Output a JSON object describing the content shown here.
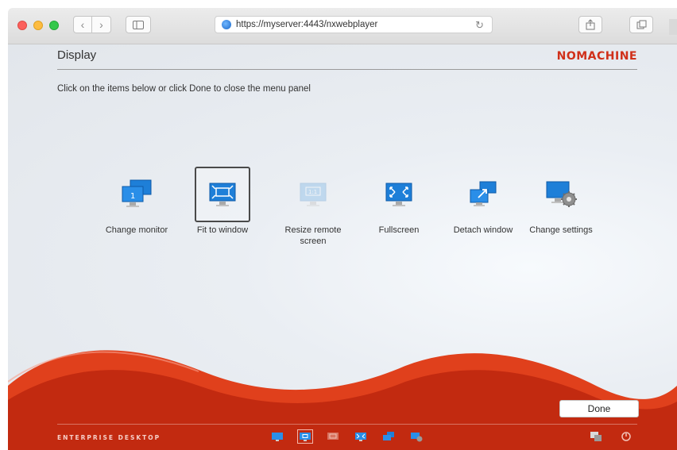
{
  "browser": {
    "url": "https://myserver:4443/nxwebplayer",
    "back_glyph": "‹",
    "forward_glyph": "›",
    "reload_glyph": "↻"
  },
  "header": {
    "title": "Display",
    "brand": "NOMACHINE"
  },
  "instruction": "Click on the items below or click Done to close the menu panel",
  "items": [
    {
      "label": "Change monitor",
      "icon": "change-monitor-icon",
      "selected": false,
      "disabled": false
    },
    {
      "label": "Fit to window",
      "icon": "fit-to-window-icon",
      "selected": true,
      "disabled": false
    },
    {
      "label": "Resize remote screen",
      "icon": "resize-remote-screen-icon",
      "selected": false,
      "disabled": true
    },
    {
      "label": "Fullscreen",
      "icon": "fullscreen-icon",
      "selected": false,
      "disabled": false
    },
    {
      "label": "Detach window",
      "icon": "detach-window-icon",
      "selected": false,
      "disabled": false
    },
    {
      "label": "Change settings",
      "icon": "change-settings-icon",
      "selected": false,
      "disabled": false
    }
  ],
  "footer": {
    "done_label": "Done",
    "edition": "ENTERPRISE DESKTOP"
  },
  "colors": {
    "brand_red": "#d0301a",
    "footer_red": "#c22a10",
    "icon_blue": "#1e7fd8"
  }
}
